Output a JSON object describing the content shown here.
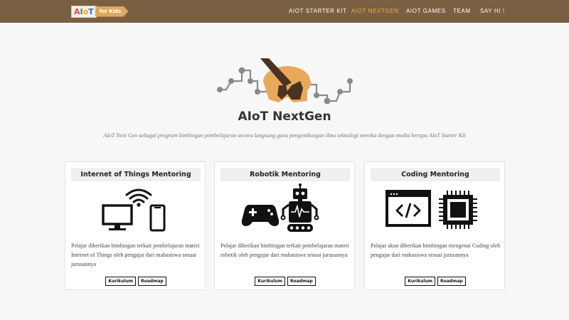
{
  "navbar": {
    "logo": {
      "aiot": "AIoT",
      "for_kids": "for Kids"
    },
    "items": [
      {
        "label": "AIOT STARTER KIT",
        "active": false
      },
      {
        "label": "AIOT NEXTGEN",
        "active": true
      },
      {
        "label": "AIOT GAMES",
        "active": false
      },
      {
        "label": "TEAM",
        "active": false
      },
      {
        "label": "SAY HI !",
        "active": false
      }
    ]
  },
  "hero": {
    "title": "AIoT NextGen",
    "subtitle": "AIoT Next Gen sebagai program bimbingan pembelajaran secara langsung guna pengembangan ilmu teknologi mereka dengan media berupa AIoT Starter Kit"
  },
  "cards": [
    {
      "title": "Internet of Things Mentoring",
      "icon": "iot-devices-icon",
      "description": "Pelajar diberikan bimbingan terkait pembelajaran materi Internet of Things oleh pengajar dari mahasiswa sesuai jurusannya",
      "buttons": [
        "Kurikulum",
        "Roadmap"
      ]
    },
    {
      "title": "Robotik Mentoring",
      "icon": "robot-gamepad-icon",
      "description": "Pelajar diberikan bimbingan terkait pembelajaran materi robotik oleh pengajar dari mahasiswa sesuai jurusannya",
      "buttons": [
        "Kurikulum",
        "Roadmap"
      ]
    },
    {
      "title": "Coding Mentoring",
      "icon": "code-chip-icon",
      "description": "Pelajar akan diberikan bimbingan mengenai Coding oleh pengajar dari mahasiswa sesuai jurusannya",
      "buttons": [
        "Kurikulum",
        "Roadmap"
      ]
    }
  ],
  "colors": {
    "navbar_bg": "#7a5f43",
    "nav_active": "#f0b24a",
    "hero_orange": "#e8a95a",
    "hero_dark": "#4a3322",
    "circuit_gray": "#8a8a8a",
    "page_bg": "#f7f7f7"
  }
}
